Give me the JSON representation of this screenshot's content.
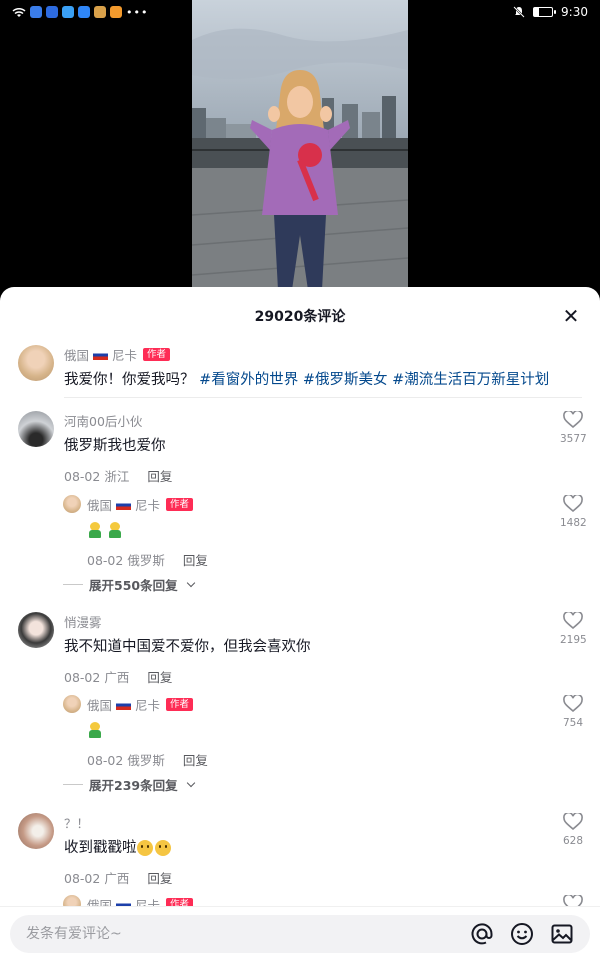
{
  "status": {
    "time": "9:30",
    "battery_level": 0.3
  },
  "sheet": {
    "title": "29020条评论",
    "close_label": "✕"
  },
  "author_post": {
    "name": "俄国",
    "name_suffix": "尼卡",
    "badge": "作者",
    "text": "我爱你！你爱我吗？",
    "hashtags": [
      "#看窗外的世界",
      "#俄罗斯美女",
      "#潮流生活百万新星计划"
    ]
  },
  "comments": [
    {
      "name": "河南00后小伙",
      "text": "俄罗斯我也爱你",
      "date": "08-02",
      "location": "浙江",
      "reply_label": "回复",
      "likes": "3577",
      "reply": {
        "name": "俄国",
        "name_suffix": "尼卡",
        "badge": "作者",
        "date": "08-02",
        "location": "俄罗斯",
        "reply_label": "回复",
        "likes": "1482"
      },
      "expand": "展开550条回复"
    },
    {
      "name": "悄漫雾",
      "text": "我不知道中国爱不爱你，但我会喜欢你",
      "date": "08-02",
      "location": "广西",
      "reply_label": "回复",
      "likes": "2195",
      "reply": {
        "name": "俄国",
        "name_suffix": "尼卡",
        "badge": "作者",
        "date": "08-02",
        "location": "俄罗斯",
        "reply_label": "回复",
        "likes": "754"
      },
      "expand": "展开239条回复"
    },
    {
      "name": "？！",
      "text": "收到戳戳啦",
      "date": "08-02",
      "location": "广西",
      "reply_label": "回复",
      "likes": "628"
    }
  ],
  "partial_reply": {
    "name": "俄国",
    "name_suffix": "尼卡",
    "badge": "作者"
  },
  "input": {
    "placeholder": "发条有爱评论~"
  },
  "icons": {
    "mention": "at-icon",
    "emoji": "smiley-icon",
    "image": "image-icon"
  },
  "colors": {
    "accent": "#fe2c55",
    "hashtag": "#04498d",
    "meta": "#8a8b91"
  }
}
